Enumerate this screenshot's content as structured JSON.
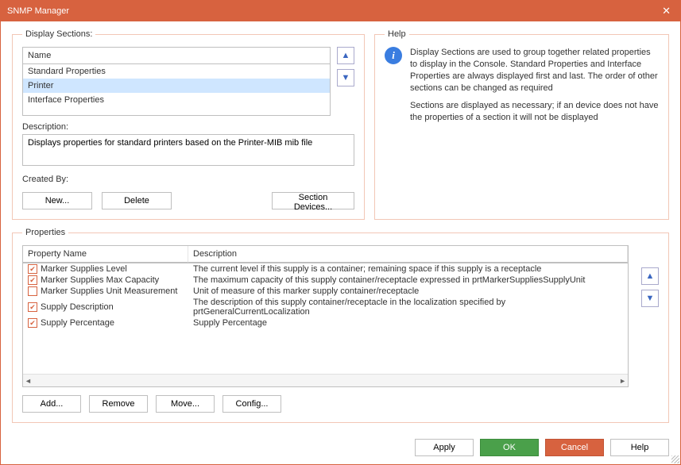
{
  "window": {
    "title": "SNMP Manager"
  },
  "displaySections": {
    "legend": "Display Sections:",
    "nameHeader": "Name",
    "items": [
      {
        "name": "Standard Properties",
        "selected": false
      },
      {
        "name": "Printer",
        "selected": true
      },
      {
        "name": "Interface Properties",
        "selected": false
      }
    ],
    "descriptionLabel": "Description:",
    "descriptionValue": "Displays properties for standard printers based on the Printer-MIB mib file",
    "createdByLabel": "Created By:",
    "buttons": {
      "new": "New...",
      "delete": "Delete",
      "sectionDevices": "Section Devices..."
    }
  },
  "help": {
    "legend": "Help",
    "para1": "Display Sections are used to group together related properties to display in the Console. Standard Properties and Interface Properties are always displayed first and last. The order of other sections can be changed as required",
    "para2": "Sections are displayed as necessary; if an device does not have the properties of a section it will not be displayed"
  },
  "properties": {
    "legend": "Properties",
    "headers": {
      "name": "Property Name",
      "desc": "Description"
    },
    "rows": [
      {
        "checked": true,
        "name": "Marker Supplies Level",
        "desc": "The current level if this supply is a container; remaining space if this supply is a receptacle"
      },
      {
        "checked": true,
        "name": "Marker Supplies Max Capacity",
        "desc": "The maximum capacity of this supply container/receptacle expressed in prtMarkerSuppliesSupplyUnit"
      },
      {
        "checked": false,
        "name": "Marker Supplies Unit Measurement",
        "desc": "Unit of measure of this marker supply container/receptacle"
      },
      {
        "checked": true,
        "name": "Supply Description",
        "desc": "The description of this supply container/receptacle in the localization specified by prtGeneralCurrentLocalization"
      },
      {
        "checked": true,
        "name": "Supply Percentage",
        "desc": "Supply Percentage"
      }
    ],
    "buttons": {
      "add": "Add...",
      "remove": "Remove",
      "move": "Move...",
      "config": "Config..."
    }
  },
  "footer": {
    "apply": "Apply",
    "ok": "OK",
    "cancel": "Cancel",
    "help": "Help"
  }
}
